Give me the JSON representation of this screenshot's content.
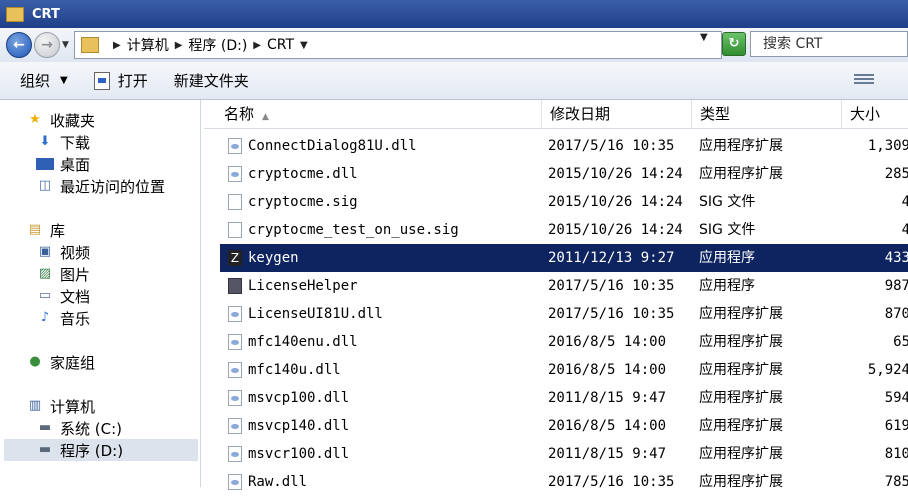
{
  "window": {
    "title": "CRT"
  },
  "address": {
    "crumbs": [
      "计算机",
      "程序 (D:)",
      "CRT"
    ],
    "search_placeholder": "搜索 CRT"
  },
  "toolbar": {
    "organize": "组织",
    "open": "打开",
    "new_folder": "新建文件夹"
  },
  "sidebar": {
    "favorites": "收藏夹",
    "downloads": "下载",
    "desktop": "桌面",
    "recent": "最近访问的位置",
    "libraries": "库",
    "videos": "视频",
    "pictures": "图片",
    "documents": "文档",
    "music": "音乐",
    "homegroup": "家庭组",
    "computer": "计算机",
    "drive_c": "系统 (C:)",
    "drive_d": "程序 (D:)"
  },
  "columns": {
    "name": "名称",
    "date": "修改日期",
    "type": "类型",
    "size": "大小"
  },
  "files": [
    {
      "name": "ConnectDialog81U.dll",
      "date": "2017/5/16 10:35",
      "type": "应用程序扩展",
      "size": "1,309",
      "icon": "dll-icon"
    },
    {
      "name": "cryptocme.dll",
      "date": "2015/10/26 14:24",
      "type": "应用程序扩展",
      "size": "285",
      "icon": "dll-icon"
    },
    {
      "name": "cryptocme.sig",
      "date": "2015/10/26 14:24",
      "type": "SIG 文件",
      "size": "4",
      "icon": "file-icon"
    },
    {
      "name": "cryptocme_test_on_use.sig",
      "date": "2015/10/26 14:24",
      "type": "SIG 文件",
      "size": "4",
      "icon": "file-icon"
    },
    {
      "name": "keygen",
      "date": "2011/12/13 9:27",
      "type": "应用程序",
      "size": "433",
      "icon": "keygen-icon"
    },
    {
      "name": "LicenseHelper",
      "date": "2017/5/16 10:35",
      "type": "应用程序",
      "size": "987",
      "icon": "license-helper-icon"
    },
    {
      "name": "LicenseUI81U.dll",
      "date": "2017/5/16 10:35",
      "type": "应用程序扩展",
      "size": "870",
      "icon": "dll-icon"
    },
    {
      "name": "mfc140enu.dll",
      "date": "2016/8/5 14:00",
      "type": "应用程序扩展",
      "size": "65",
      "icon": "dll-icon"
    },
    {
      "name": "mfc140u.dll",
      "date": "2016/8/5 14:00",
      "type": "应用程序扩展",
      "size": "5,924",
      "icon": "dll-icon"
    },
    {
      "name": "msvcp100.dll",
      "date": "2011/8/15 9:47",
      "type": "应用程序扩展",
      "size": "594",
      "icon": "dll-icon"
    },
    {
      "name": "msvcp140.dll",
      "date": "2016/8/5 14:00",
      "type": "应用程序扩展",
      "size": "619",
      "icon": "dll-icon"
    },
    {
      "name": "msvcr100.dll",
      "date": "2011/8/15 9:47",
      "type": "应用程序扩展",
      "size": "810",
      "icon": "dll-icon"
    },
    {
      "name": "Raw.dll",
      "date": "2017/5/16 10:35",
      "type": "应用程序扩展",
      "size": "785",
      "icon": "dll-icon"
    }
  ],
  "colors": {
    "selection": "#0e2460",
    "title_bar": "#2a4a98"
  }
}
